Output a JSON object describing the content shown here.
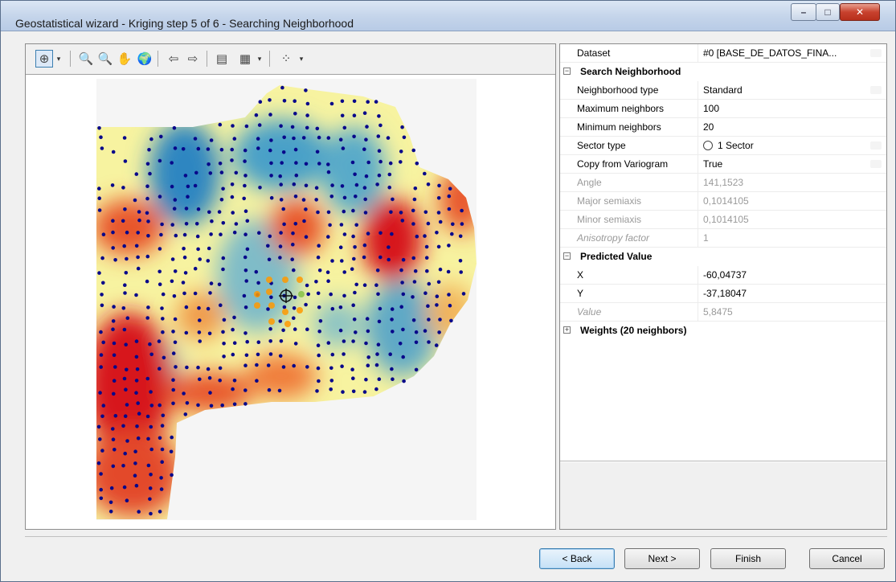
{
  "window": {
    "title": "Geostatistical wizard - Kriging step 5 of 6 - Searching Neighborhood",
    "min_glyph": "–",
    "max_glyph": "□",
    "close_glyph": "✕"
  },
  "toolbar": {
    "items": [
      {
        "name": "select-tool-icon",
        "glyph": "⊕"
      },
      {
        "name": "dropdown-arrow-icon",
        "glyph": "▾"
      },
      {
        "name": "zoom-in-icon",
        "glyph": "🔍"
      },
      {
        "name": "zoom-out-icon",
        "glyph": "🔍"
      },
      {
        "name": "pan-hand-icon",
        "glyph": "✋"
      },
      {
        "name": "globe-full-extent-icon",
        "glyph": "🌍"
      },
      {
        "name": "back-arrow-icon",
        "glyph": "⇦"
      },
      {
        "name": "forward-arrow-icon",
        "glyph": "⇨"
      },
      {
        "name": "identify-list-icon",
        "glyph": "▤"
      },
      {
        "name": "legend-icon",
        "glyph": "▦"
      },
      {
        "name": "dropdown-arrow-icon",
        "glyph": "▾"
      },
      {
        "name": "symbology-points-icon",
        "glyph": "⁘"
      },
      {
        "name": "dropdown-arrow-icon",
        "glyph": "▾"
      }
    ]
  },
  "properties": {
    "dataset": {
      "label": "Dataset",
      "value": "#0 [BASE_DE_DATOS_FINA..."
    },
    "search_neighborhood": {
      "header": "Search Neighborhood",
      "rows": [
        {
          "label": "Neighborhood type",
          "value": "Standard"
        },
        {
          "label": "Maximum neighbors",
          "value": "100"
        },
        {
          "label": "Minimum neighbors",
          "value": "20"
        },
        {
          "label": "Sector type",
          "value": "1 Sector"
        },
        {
          "label": "Copy from Variogram",
          "value": "True"
        },
        {
          "label": "Angle",
          "value": "141,1523"
        },
        {
          "label": "Major semiaxis",
          "value": "0,1014105"
        },
        {
          "label": "Minor semiaxis",
          "value": "0,1014105"
        },
        {
          "label": "Anisotropy factor",
          "value": "1"
        }
      ]
    },
    "predicted_value": {
      "header": "Predicted Value",
      "rows": [
        {
          "label": "X",
          "value": "-60,04737"
        },
        {
          "label": "Y",
          "value": "-37,18047"
        },
        {
          "label": "Value",
          "value": "5,8475"
        }
      ]
    },
    "weights": {
      "header": "Weights (20 neighbors)"
    }
  },
  "map": {
    "colors": {
      "low": "#2b83ba",
      "mid": "#ffffbf",
      "high": "#d7191c",
      "points": "#08088a",
      "selected": "#ff9900",
      "background": "#f5f5f5"
    }
  },
  "buttons": {
    "back": "< Back",
    "next": "Next >",
    "finish": "Finish",
    "cancel": "Cancel"
  }
}
